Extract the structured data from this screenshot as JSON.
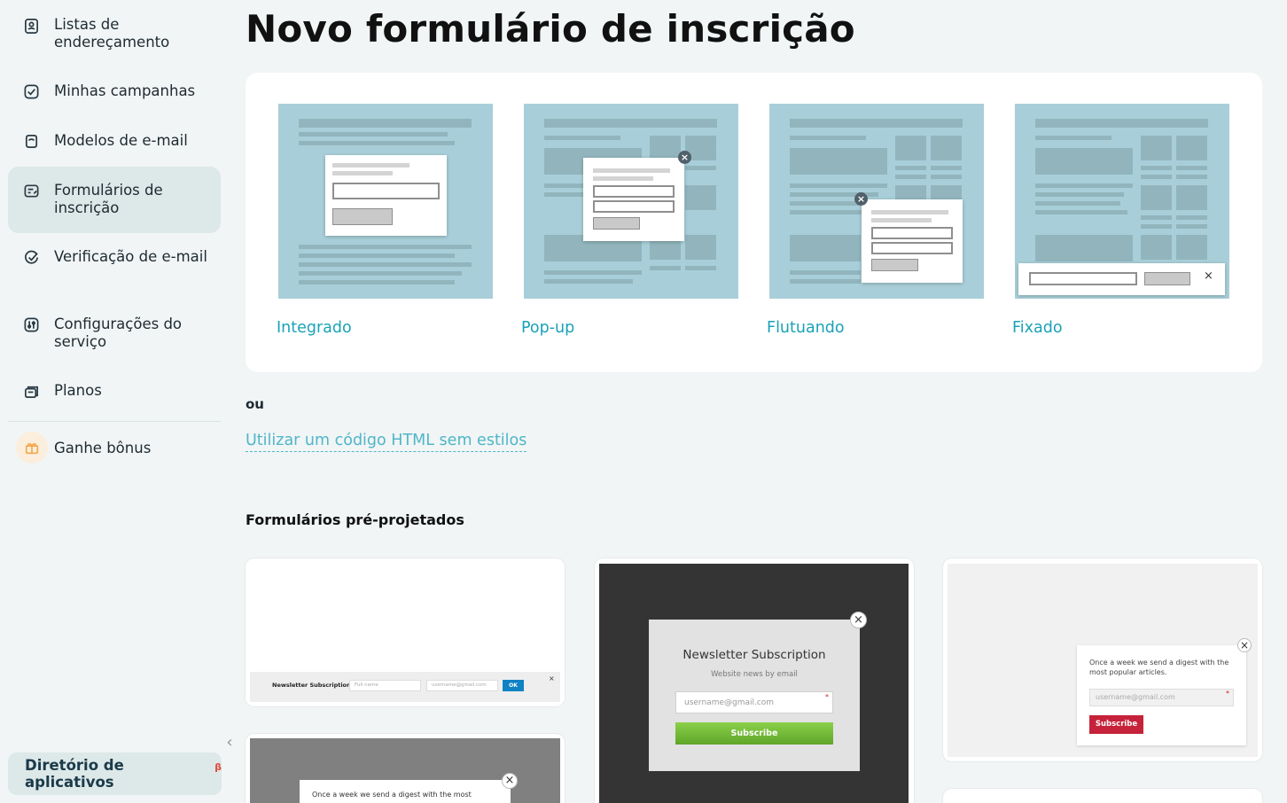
{
  "sidebar": {
    "items": [
      {
        "label": "Listas de endereçamento",
        "icon": "contacts-icon"
      },
      {
        "label": "Minhas campanhas",
        "icon": "campaign-icon"
      },
      {
        "label": "Modelos de e-mail",
        "icon": "templates-icon"
      },
      {
        "label": "Formulários de inscrição",
        "icon": "form-icon"
      },
      {
        "label": "Verificação de e-mail",
        "icon": "check-icon"
      },
      {
        "label": "Configurações do serviço",
        "icon": "settings-icon"
      },
      {
        "label": "Planos",
        "icon": "plans-icon"
      },
      {
        "label": "Ganhe bônus",
        "icon": "gift-icon"
      }
    ],
    "app_directory": {
      "label": "Diretório de aplicativos",
      "badge": "β"
    }
  },
  "page": {
    "title": "Novo formulário de inscrição",
    "form_types": [
      {
        "label": "Integrado"
      },
      {
        "label": "Pop-up"
      },
      {
        "label": "Flutuando"
      },
      {
        "label": "Fixado"
      }
    ],
    "or_label": "ou",
    "html_link": "Utilizar um código HTML sem estilos",
    "predesigned_title": "Formulários pré-projetados"
  },
  "previews": {
    "bar": {
      "title": "Newsletter Subscription",
      "name_ph": "Full name",
      "email_ph": "username@gmail.com",
      "ok": "OK"
    },
    "dark": {
      "title": "Newsletter Subscription",
      "subtitle": "Website news by email",
      "email_ph": "username@gmail.com",
      "button": "Subscribe"
    },
    "light": {
      "text": "Once a week we send a digest with the most popular articles.",
      "email_ph": "username@gmail.com",
      "button": "Subscribe"
    },
    "partial": {
      "text": "Once a week we send a digest with the most"
    }
  },
  "colors": {
    "accent": "#1aa2b7",
    "tile": "#a8cfd9",
    "green": "#7cbf3a",
    "red": "#c6223b"
  }
}
